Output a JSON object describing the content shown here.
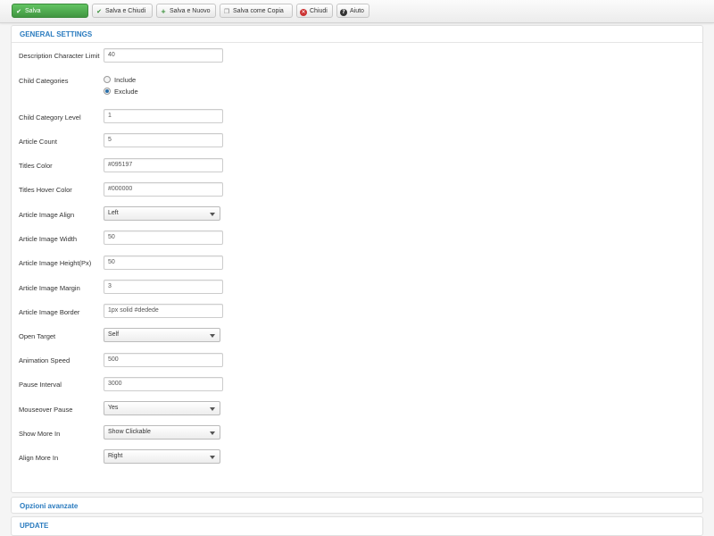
{
  "toolbar": {
    "save": "Salva",
    "save_close": "Salva e Chiudi",
    "save_new": "Salva e Nuovo",
    "save_copy": "Salva come Copia",
    "close": "Chiudi",
    "help": "Aiuto"
  },
  "panels": {
    "general": "GENERAL SETTINGS",
    "advanced": "Opzioni avanzate",
    "update": "UPDATE"
  },
  "fields": {
    "desc_limit": {
      "label": "Description Character Limit",
      "value": "40"
    },
    "child_categories": {
      "label": "Child Categories",
      "options": [
        "Include",
        "Exclude"
      ],
      "selected": "Exclude"
    },
    "child_level": {
      "label": "Child Category Level",
      "value": "1"
    },
    "article_count": {
      "label": "Article Count",
      "value": "5"
    },
    "titles_color": {
      "label": "Titles Color",
      "value": "#095197"
    },
    "titles_hover": {
      "label": "Titles Hover Color",
      "value": "#000000"
    },
    "image_align": {
      "label": "Article Image Align",
      "value": "Left"
    },
    "image_width": {
      "label": "Article Image Width",
      "value": "50"
    },
    "image_height": {
      "label": "Article Image Height(Px)",
      "value": "50"
    },
    "image_margin": {
      "label": "Article Image Margin",
      "value": "3"
    },
    "image_border": {
      "label": "Article Image Border",
      "value": "1px solid #dedede"
    },
    "open_target": {
      "label": "Open Target",
      "value": "Self"
    },
    "anim_speed": {
      "label": "Animation Speed",
      "value": "500"
    },
    "pause_interval": {
      "label": "Pause Interval",
      "value": "3000"
    },
    "mouseover_pause": {
      "label": "Mouseover Pause",
      "value": "Yes"
    },
    "show_more": {
      "label": "Show More In",
      "value": "Show Clickable"
    },
    "align_more": {
      "label": "Align More In",
      "value": "Right"
    }
  },
  "colors": {
    "primary_button": "#51a351",
    "link": "#2a7bbf",
    "radio_selected": "#2a6fa8"
  },
  "icons": [
    "check-icon",
    "plus-icon",
    "copy-icon",
    "close-circle-icon",
    "help-circle-icon"
  ]
}
